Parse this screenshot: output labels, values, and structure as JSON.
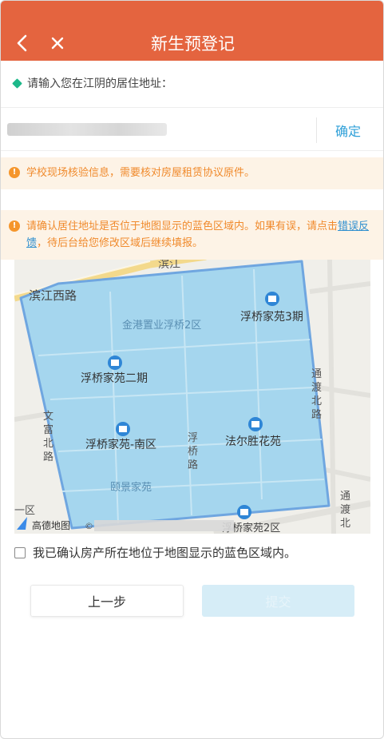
{
  "header": {
    "title": "新生预登记",
    "back_icon": "chevron-left-icon",
    "close_icon": "close-icon",
    "background": "#e4643f"
  },
  "form": {
    "prompt": "请输入您在江阴的居住地址：",
    "address_value": "",
    "confirm_label": "确定"
  },
  "notices": {
    "notice1": "学校现场核验信息，需要核对房屋租赁协议原件。",
    "notice2_before_link": "请确认居住地址是否位于地图显示的蓝色区域内。如果有误，请点击",
    "notice2_link": "错误反馈",
    "notice2_after_link": "，待后台给您修改区域后继续填报。",
    "icon": "exclamation-icon"
  },
  "map": {
    "labels": {
      "road_binjiang": "滨江西路",
      "area_top": "金港置业浮桥2区",
      "poi_fq3": "浮桥家苑3期",
      "poi_fq2": "浮桥家苑二期",
      "poi_fqnq": "浮桥家苑-南区",
      "poi_fesh": "法尔胜花苑",
      "area_yj": "颐景家苑",
      "road_fq": "浮桥路",
      "road_wf": "文富北路",
      "road_td": "通渡北路",
      "road_td2": "通渡北",
      "road_jiang": "滨江",
      "area_left": "一区",
      "area_bottom": "浮桥家苑2区",
      "logo": "高德地图",
      "copyright": "©"
    },
    "region_color": "#9fd3ec"
  },
  "agreement": {
    "label": "我已确认房产所在地位于地图显示的蓝色区域内。",
    "checked": false
  },
  "buttons": {
    "prev": "上一步",
    "next": "提交"
  }
}
